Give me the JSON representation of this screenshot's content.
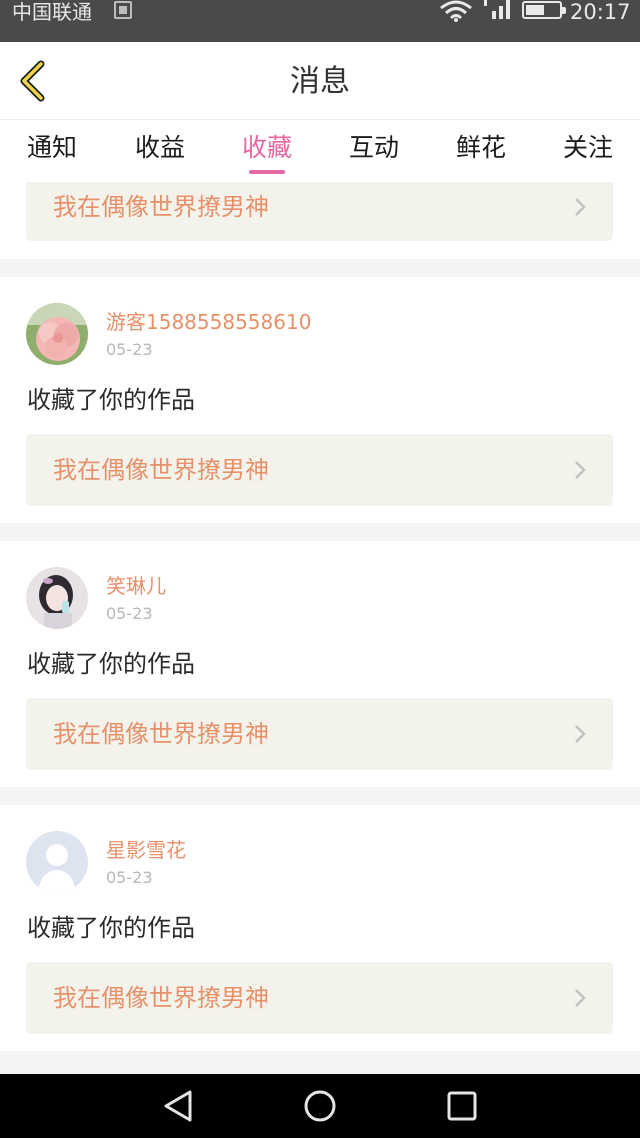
{
  "status_bar": {
    "carrier": "中国联通",
    "time": "20:17",
    "battery_level": 0.55
  },
  "header": {
    "title": "消息",
    "back_icon": "chevron-left-icon"
  },
  "tabs": [
    {
      "label": "通知",
      "active": false
    },
    {
      "label": "收益",
      "active": false
    },
    {
      "label": "收藏",
      "active": true
    },
    {
      "label": "互动",
      "active": false
    },
    {
      "label": "鲜花",
      "active": false
    },
    {
      "label": "关注",
      "active": false
    }
  ],
  "notifications": {
    "partial_top": {
      "work_title": "我在偶像世界撩男神"
    },
    "items": [
      {
        "username": "游客1588558558610",
        "date": "05-23",
        "action": "收藏了你的作品",
        "work_title": "我在偶像世界撩男神",
        "avatar": "flower-avatar"
      },
      {
        "username": "笑琳儿",
        "date": "05-23",
        "action": "收藏了你的作品",
        "work_title": "我在偶像世界撩男神",
        "avatar": "girl-photo-avatar"
      },
      {
        "username": "星影雪花",
        "date": "05-23",
        "action": "收藏了你的作品",
        "work_title": "我在偶像世界撩男神",
        "avatar": "default-user-avatar"
      }
    ]
  },
  "nav_bar": {
    "back_icon": "triangle-back-icon",
    "home_icon": "circle-home-icon",
    "recents_icon": "square-recents-icon"
  },
  "colors": {
    "accent_pink": "#e368a3",
    "orange_text": "#e8906a",
    "link_background": "#f3f3ec",
    "status_bar": "#4a4a4a"
  }
}
